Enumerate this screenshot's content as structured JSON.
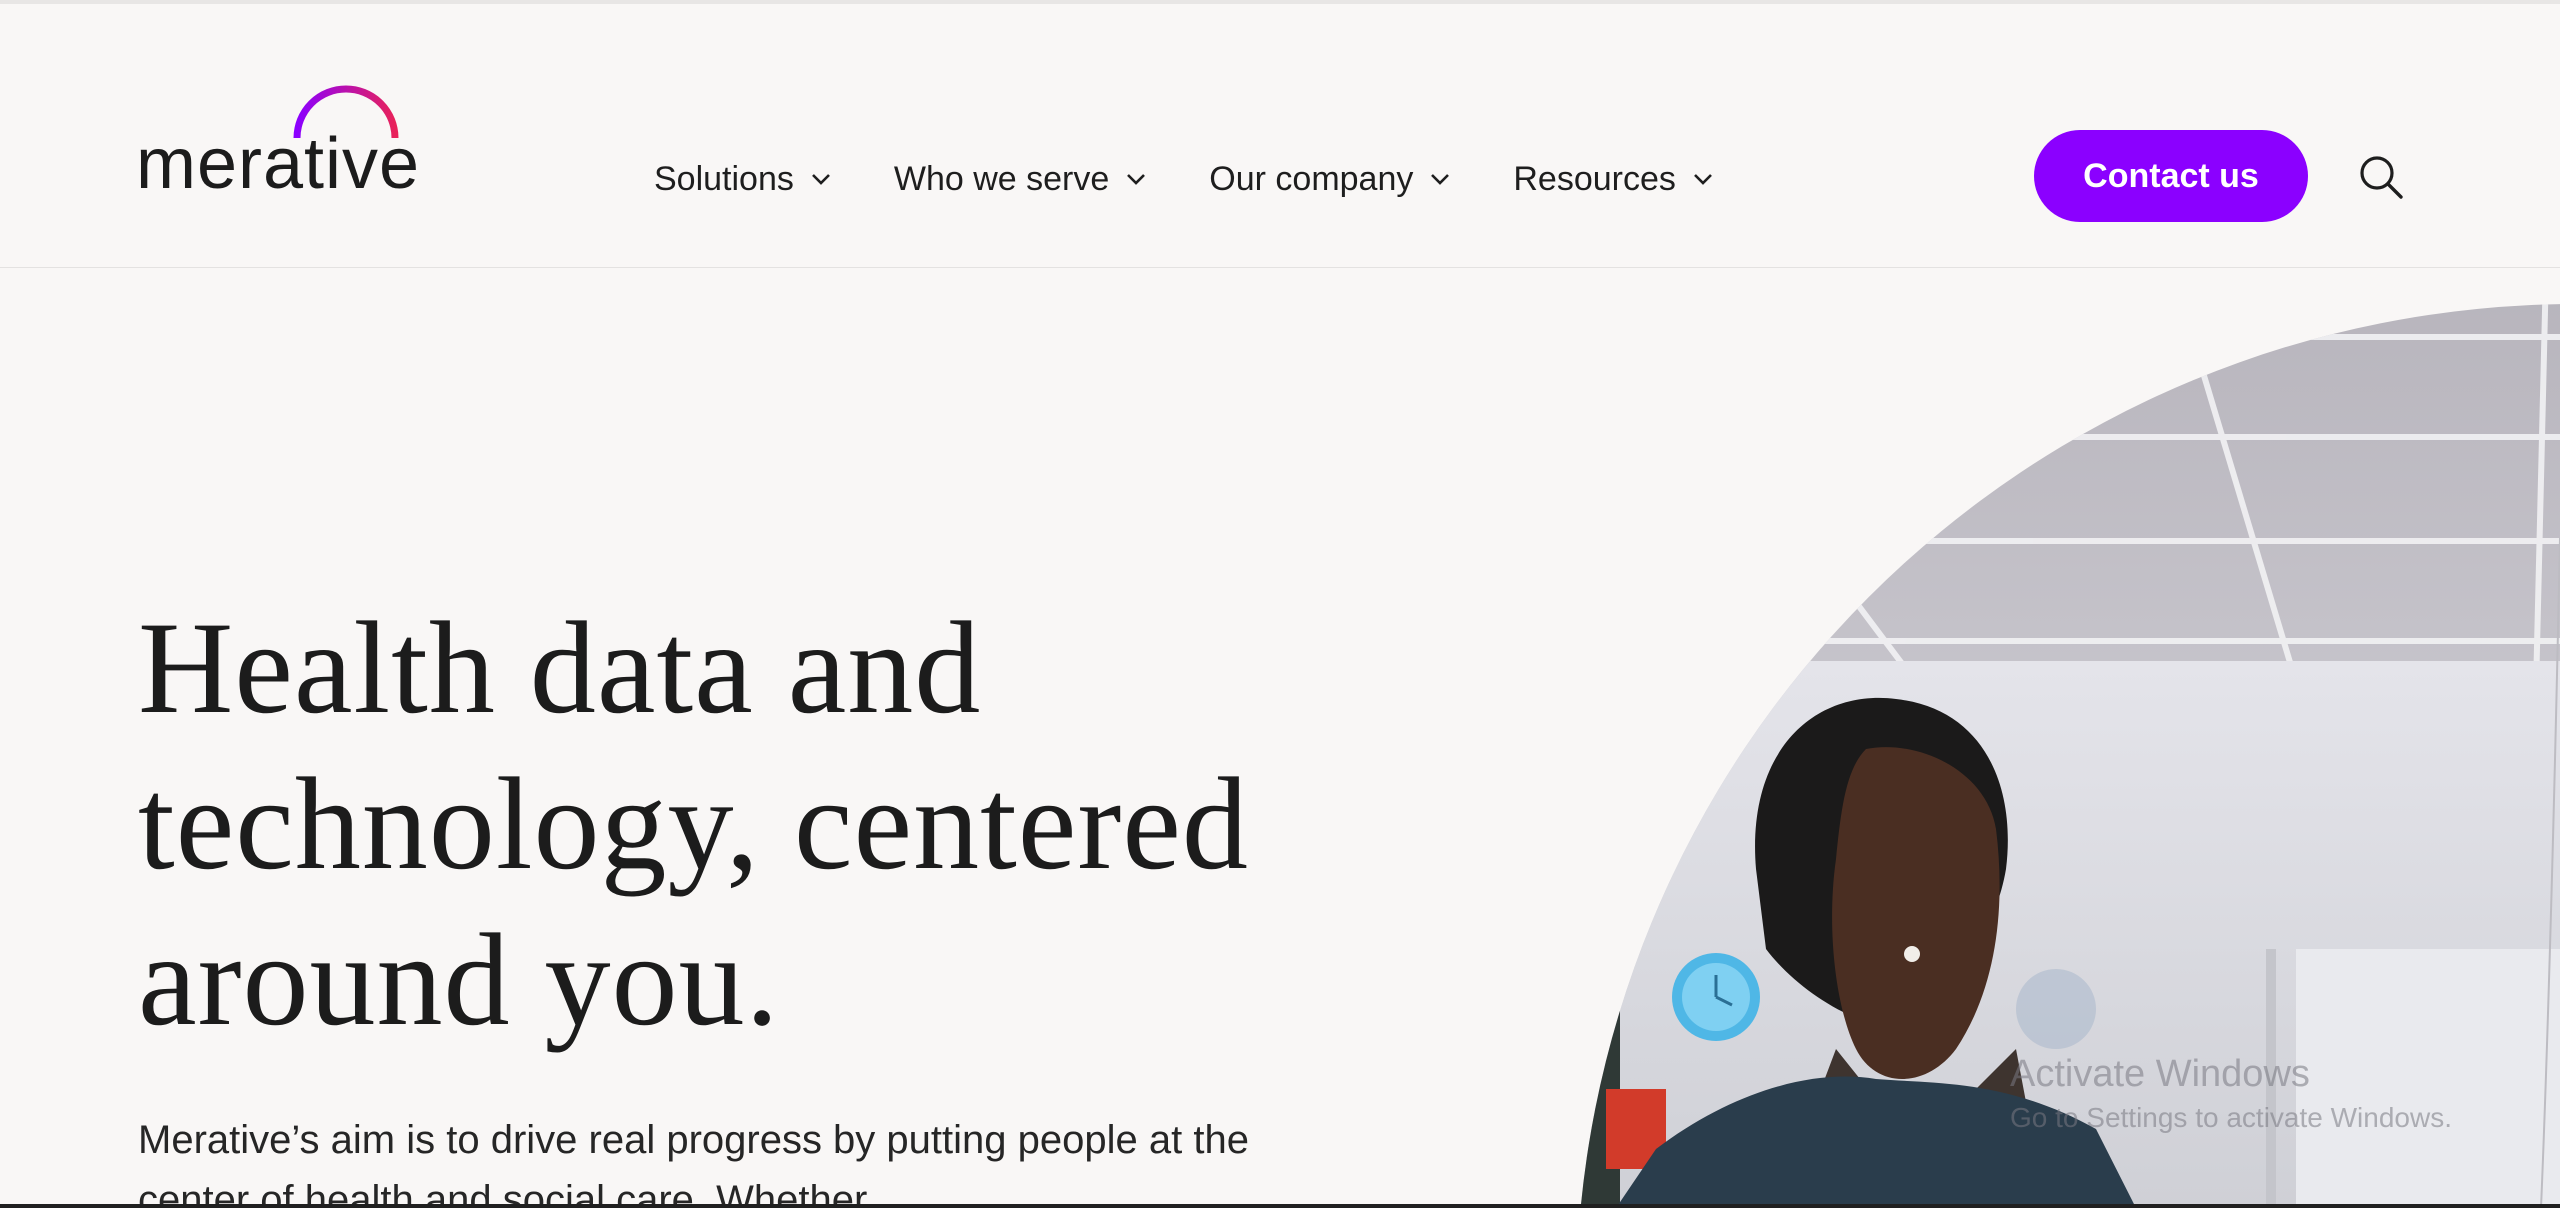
{
  "brand": {
    "name": "merative",
    "accent_color": "#8b00ff",
    "logo_arc_colors": [
      "#8b00ff",
      "#e8225a"
    ]
  },
  "nav": {
    "items": [
      {
        "label": "Solutions",
        "icon": "chevron-down-icon"
      },
      {
        "label": "Who we serve",
        "icon": "chevron-down-icon"
      },
      {
        "label": "Our company",
        "icon": "chevron-down-icon"
      },
      {
        "label": "Resources",
        "icon": "chevron-down-icon"
      }
    ],
    "contact_label": "Contact us",
    "search_icon": "search-icon"
  },
  "hero": {
    "headline_lines": [
      "Health data and",
      "technology, centered",
      "around you."
    ],
    "lead_text": "Merative’s aim is to drive real progress by putting people at the center of health and social care. Whether"
  },
  "overlay": {
    "title": "Activate Windows",
    "subtitle": "Go to Settings to activate Windows."
  }
}
